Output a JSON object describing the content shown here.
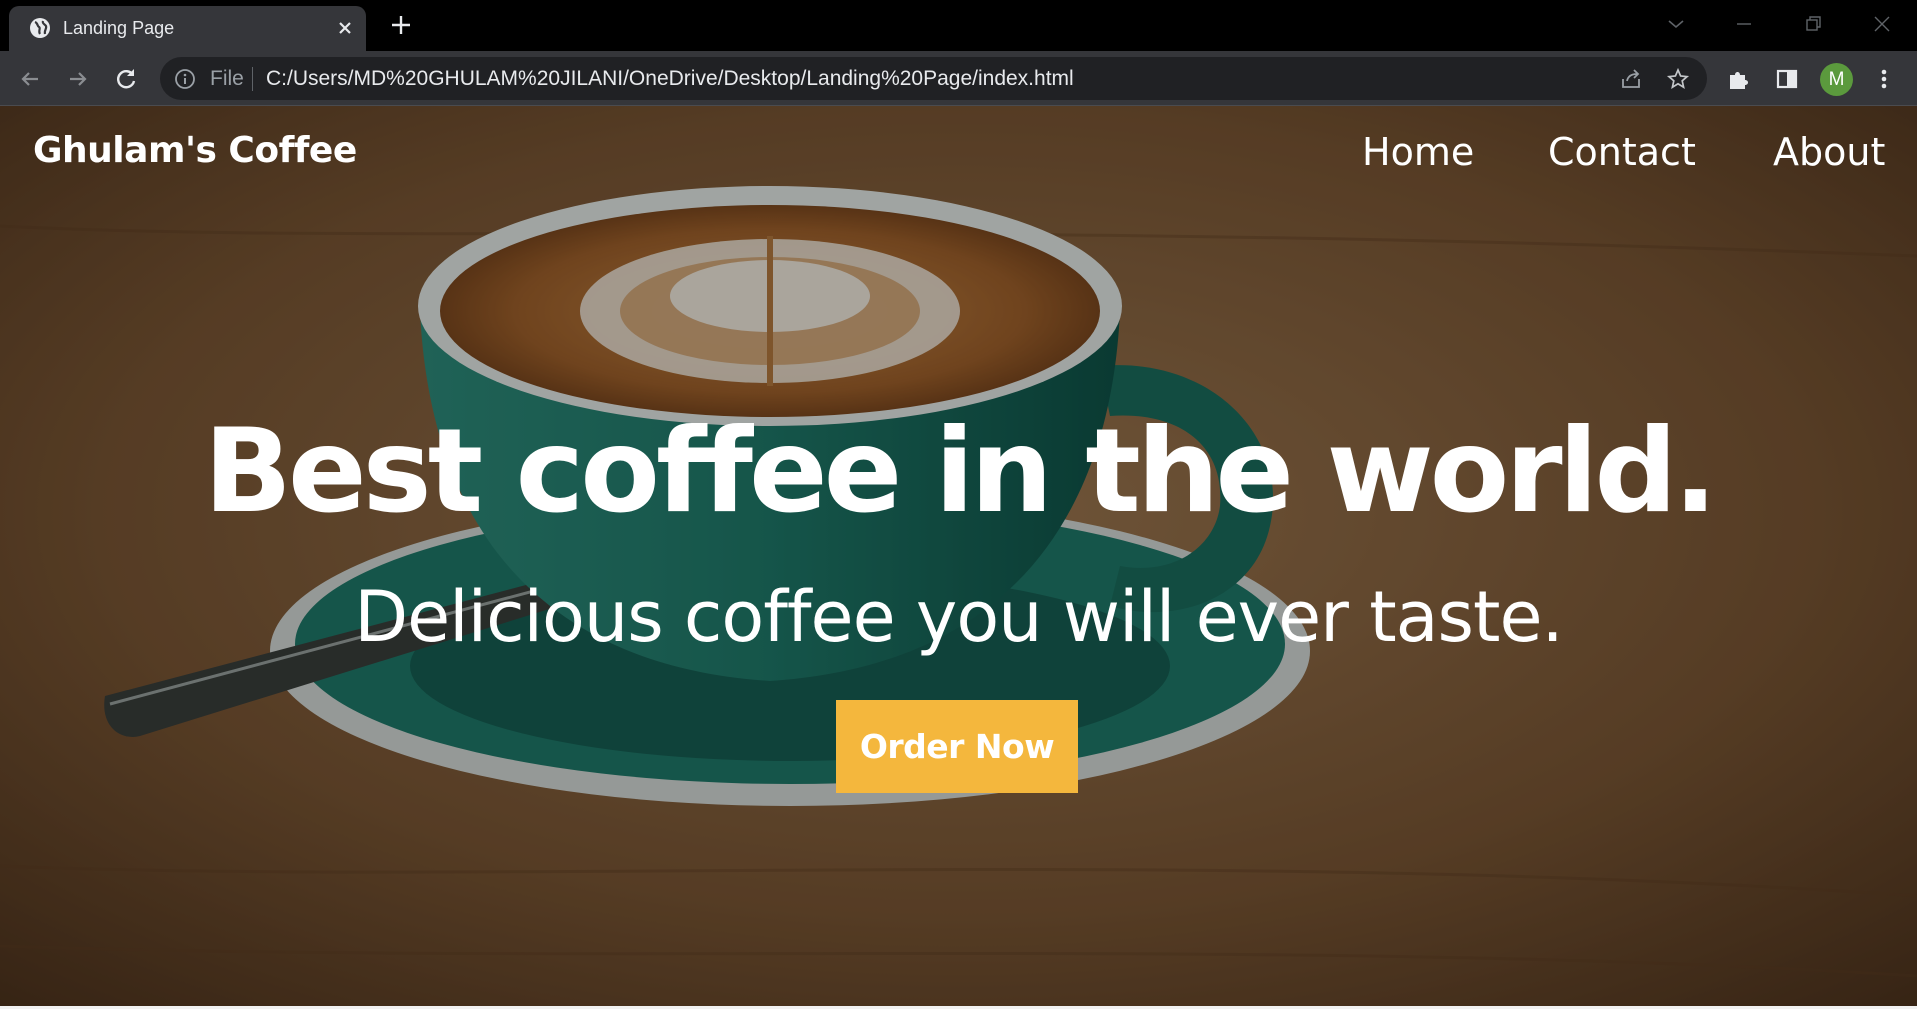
{
  "browser": {
    "tab_title": "Landing Page",
    "file_label": "File",
    "url": "C:/Users/MD%20GHULAM%20JILANI/OneDrive/Desktop/Landing%20Page/index.html",
    "profile_initial": "M",
    "icons": [
      "globe-icon",
      "close-icon",
      "plus-icon",
      "chevron-down-icon",
      "minimize-icon",
      "restore-icon",
      "window-close-icon",
      "back-arrow-icon",
      "forward-arrow-icon",
      "reload-icon",
      "info-icon",
      "share-icon",
      "star-icon",
      "puzzle-icon",
      "side-panel-icon",
      "kebab-menu-icon"
    ]
  },
  "site": {
    "brand": "Ghulam's Coffee",
    "nav": {
      "home": "Home",
      "contact": "Contact",
      "about": "About"
    },
    "headline": "Best coffee in the world.",
    "subline": "Delicious coffee you will ever taste.",
    "cta": "Order Now"
  },
  "colors": {
    "cta_background": "#f4b73d",
    "cup": "#1f7a6a",
    "table_wood": "#7a5634",
    "chrome_dark": "#35363a"
  }
}
